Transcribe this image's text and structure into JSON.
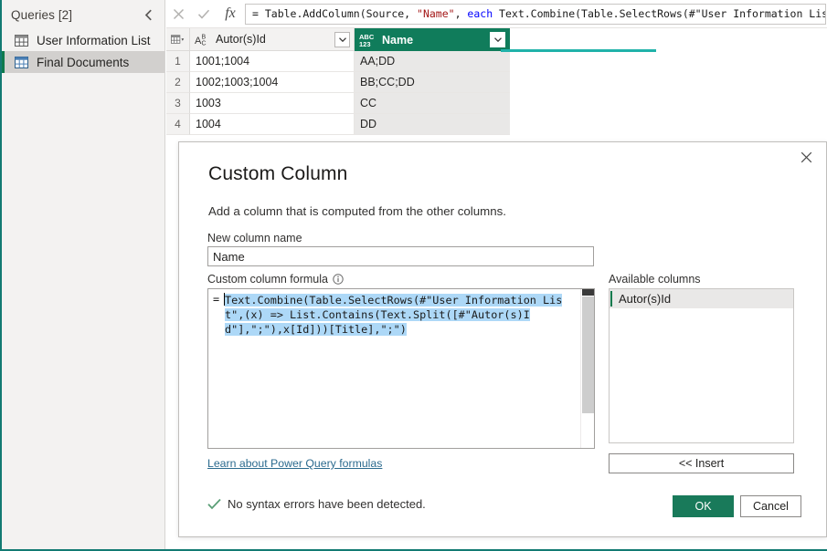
{
  "queries_pane": {
    "title": "Queries [2]",
    "collapse_icon": "chevron-left-icon",
    "items": [
      {
        "label": "User Information List",
        "icon": "table-icon",
        "selected": false
      },
      {
        "label": "Final Documents",
        "icon": "table-icon",
        "selected": true
      }
    ]
  },
  "formula_bar": {
    "cancel_icon": "x-icon",
    "accept_icon": "checkmark-icon",
    "fx_label": "fx",
    "formula_segments": [
      {
        "text": "= Table.AddColumn(Source, ",
        "kind": "code"
      },
      {
        "text": "\"Name\"",
        "kind": "string"
      },
      {
        "text": ", ",
        "kind": "code"
      },
      {
        "text": "each",
        "kind": "keyword"
      },
      {
        "text": " Text.Combine(Table.SelectRows(#\"User Information List\",(x) => List.Contains(",
        "kind": "code"
      }
    ],
    "formula_full": "= Table.AddColumn(Source, \"Name\", each Text.Combine(Table.SelectRows(#\"User Information List\",(x) => List.Contains("
  },
  "grid": {
    "corner_icon": "select-all-table-icon",
    "columns": [
      {
        "name": "Autor(s)Id",
        "type_icon": "abc-text-type-icon",
        "selected": false,
        "dropdown_icon": "chevron-down-icon"
      },
      {
        "name": "Name",
        "type_icon": "abc123-any-type-icon",
        "selected": true,
        "dropdown_icon": "chevron-down-icon"
      }
    ],
    "rows": [
      {
        "num": "1",
        "cells": [
          "1001;1004",
          "AA;DD"
        ]
      },
      {
        "num": "2",
        "cells": [
          "1002;1003;1004",
          "BB;CC;DD"
        ]
      },
      {
        "num": "3",
        "cells": [
          "1003",
          "CC"
        ]
      },
      {
        "num": "4",
        "cells": [
          "1004",
          "DD"
        ]
      }
    ]
  },
  "dialog": {
    "close_icon": "close-icon",
    "title": "Custom Column",
    "subtitle": "Add a column that is computed from the other columns.",
    "new_column_name_label": "New column name",
    "new_column_name_value": "Name",
    "new_column_name_placeholder": "New column name",
    "formula_label": "Custom column formula",
    "formula_info_icon": "info-circle-icon",
    "formula_prefix": "=",
    "formula_value": "Text.Combine(Table.SelectRows(#\"User Information List\",(x) => List.Contains(Text.Split([#\"Autor(s)Id\"],\";\"),x[Id]))[Title],\";\")",
    "learn_link": "Learn about Power Query formulas",
    "available_columns_label": "Available columns",
    "available_columns": [
      {
        "label": "Autor(s)Id",
        "selected": true
      }
    ],
    "insert_button": "<< Insert",
    "status_icon": "checkmark-icon",
    "status_text": "No syntax errors have been detected.",
    "ok_button": "OK",
    "cancel_button": "Cancel"
  },
  "colors": {
    "teal_accent": "#127a72",
    "selected_column_header": "#107c5b",
    "column_underline": "#20b2aa",
    "ok_button": "#197a5a",
    "green_bar": "#0f7a4d",
    "selection_highlight": "#add8f7",
    "string_token": "#a31515",
    "keyword_token": "#0000ff",
    "link": "#2c6b8f"
  }
}
